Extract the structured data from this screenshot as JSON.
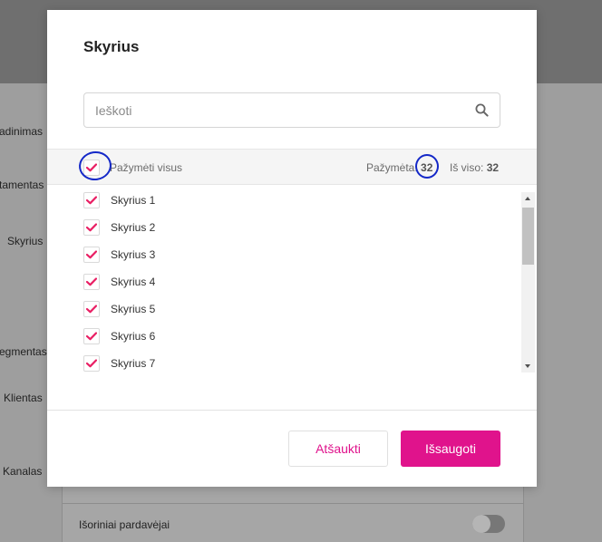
{
  "background": {
    "side_labels": [
      "adinimas",
      "tamentas",
      "Skyrius",
      "egmentas",
      "Klientas",
      "Kanalas"
    ],
    "card_row_label": "Išoriniai pardavėjai"
  },
  "modal": {
    "title": "Skyrius",
    "search": {
      "placeholder": "Ieškoti",
      "value": ""
    },
    "select_all": {
      "label": "Pažymėti visus",
      "checked": true
    },
    "selected": {
      "label": "Pažymėta:",
      "count": "32"
    },
    "total": {
      "label": "Iš viso:",
      "count": "32"
    },
    "items": [
      {
        "label": "Skyrius 1",
        "checked": true
      },
      {
        "label": "Skyrius 2",
        "checked": true
      },
      {
        "label": "Skyrius 3",
        "checked": true
      },
      {
        "label": "Skyrius 4",
        "checked": true
      },
      {
        "label": "Skyrius 5",
        "checked": true
      },
      {
        "label": "Skyrius 6",
        "checked": true
      },
      {
        "label": "Skyrius 7",
        "checked": true
      }
    ],
    "buttons": {
      "cancel": "Atšaukti",
      "save": "Išsaugoti"
    }
  },
  "colors": {
    "accent": "#e0138c",
    "annotation": "#1428c8",
    "check": "#e91e63"
  },
  "icons": {
    "search": "search-icon",
    "check": "checkmark-icon"
  }
}
